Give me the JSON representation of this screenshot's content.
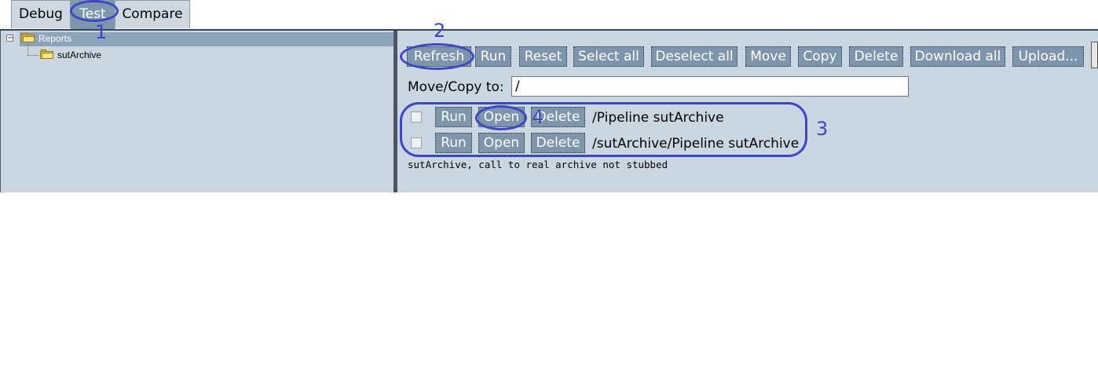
{
  "tabs": [
    {
      "label": "Debug"
    },
    {
      "label": "Test"
    },
    {
      "label": "Compare"
    }
  ],
  "tree": {
    "root_label": "Reports",
    "child_label": "sutArchive",
    "toggle_symbol": "−"
  },
  "toolbar": {
    "refresh": "Refresh",
    "run": "Run",
    "reset": "Reset",
    "select_all": "Select all",
    "deselect_all": "Deselect all",
    "move": "Move",
    "copy": "Copy",
    "delete": "Delete",
    "download_all": "Download all",
    "upload": "Upload..."
  },
  "move_copy": {
    "label": "Move/Copy to:",
    "value": "/"
  },
  "reports": [
    {
      "run": "Run",
      "open": "Open",
      "delete": "Delete",
      "path": "/Pipeline sutArchive"
    },
    {
      "run": "Run",
      "open": "Open",
      "delete": "Delete",
      "path": "/sutArchive/Pipeline sutArchive"
    }
  ],
  "note": "sutArchive, call to real archive not stubbed",
  "annotations": [
    "1",
    "2",
    "3",
    "4"
  ],
  "colors": {
    "accent": "#3b47c9",
    "button": "#7e96ac",
    "panel": "#cbd7e0"
  }
}
